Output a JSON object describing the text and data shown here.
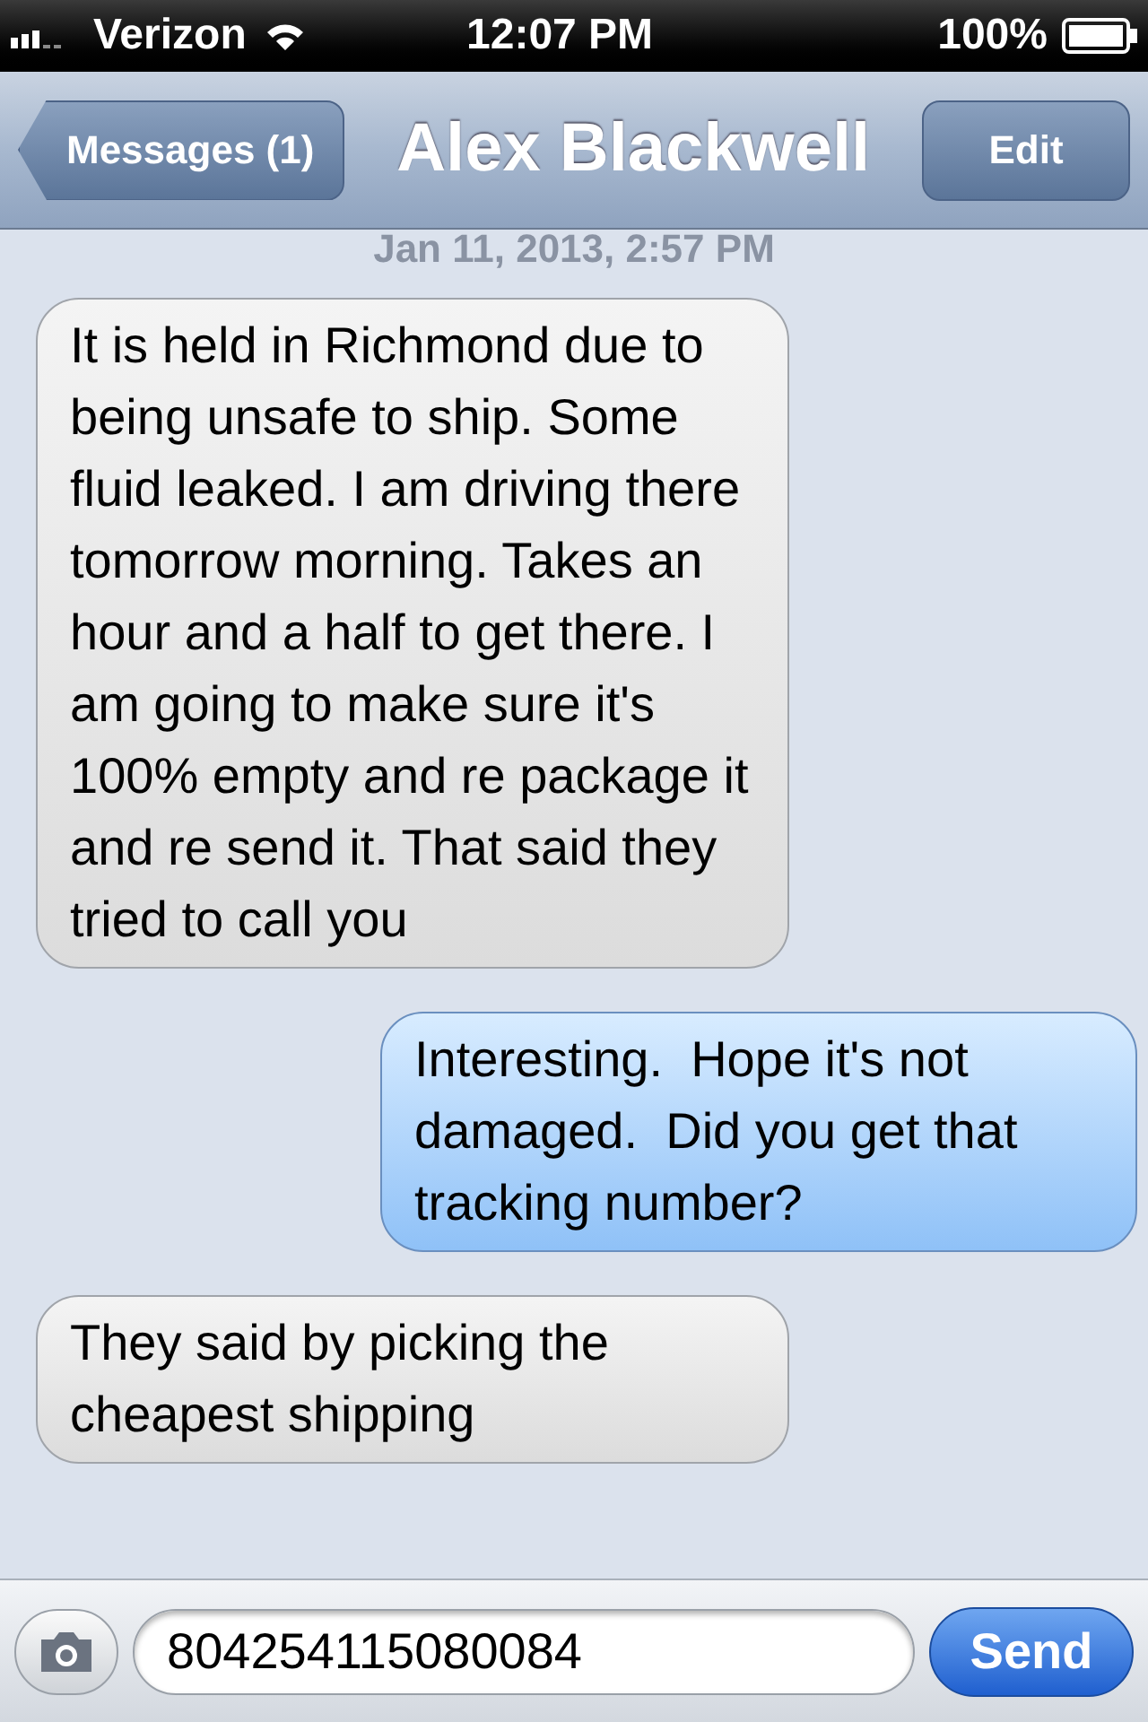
{
  "status_bar": {
    "carrier": "Verizon",
    "time": "12:07 PM",
    "battery": "100%"
  },
  "nav": {
    "back": "Messages (1)",
    "title": "Alex Blackwell",
    "edit": "Edit"
  },
  "timestamp": "Jan 11, 2013, 2:57 PM",
  "messages": [
    {
      "kind": "received",
      "text": "It is held in Richmond due to being unsafe to ship. Some fluid leaked. I am driving there tomorrow morning. Takes an hour and a half to get there. I am going to make sure it's 100% empty and re package it and re send it. That said they tried to call you"
    },
    {
      "kind": "sent",
      "text": "Interesting.  Hope it's not damaged.  Did you get that tracking number?"
    },
    {
      "kind": "received",
      "text": "They said by picking the cheapest shipping"
    }
  ],
  "composer": {
    "value": "804254115080084",
    "send": "Send"
  }
}
